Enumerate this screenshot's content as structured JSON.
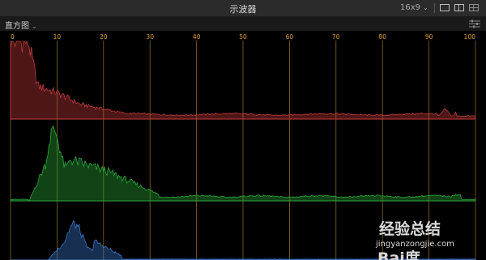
{
  "window": {
    "title": "示波器",
    "preset": "16x9"
  },
  "toolbar": {
    "mode": "直方图"
  },
  "scale": {
    "ticks": [
      "0",
      "10",
      "20",
      "30",
      "40",
      "50",
      "60",
      "70",
      "80",
      "90",
      "100"
    ]
  },
  "channels": [
    {
      "name": "red",
      "color": "#c23a3a"
    },
    {
      "name": "green",
      "color": "#2aa83a"
    },
    {
      "name": "blue",
      "color": "#3a76c8"
    }
  ],
  "colors": {
    "background": "#000000",
    "gridline": "#b78a2e",
    "tick_label": "#e0a13a"
  },
  "watermark": {
    "text": "经验总结",
    "url": "jingyanzongjie.com",
    "logo": "Bai度"
  }
}
